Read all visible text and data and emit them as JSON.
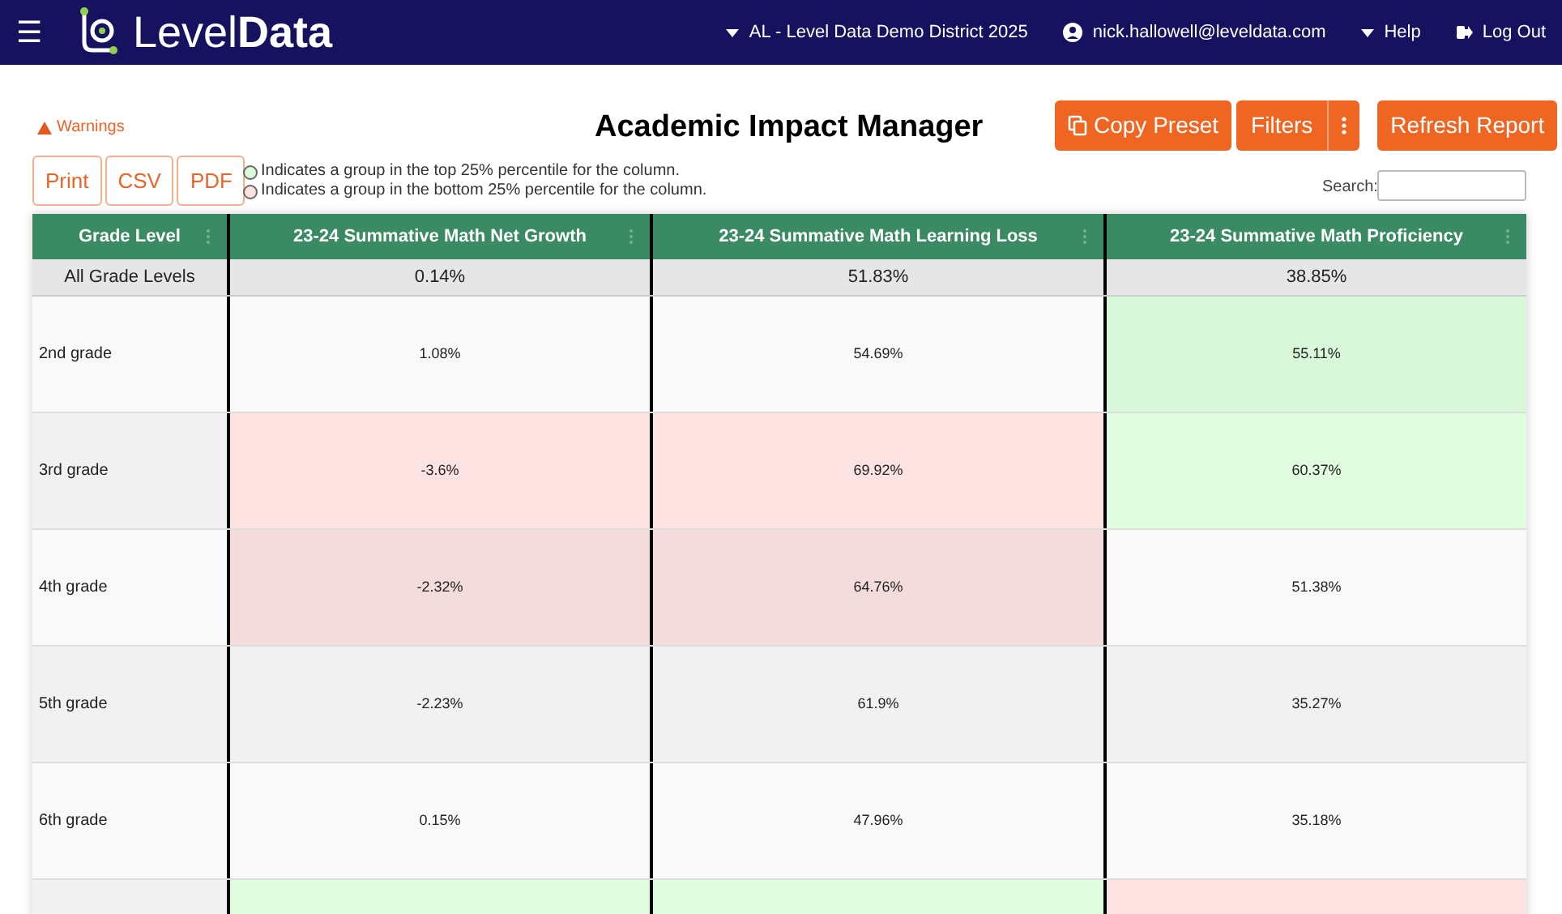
{
  "navbar": {
    "menu_icon": "☰",
    "logo": {
      "light": "Level",
      "bold": "Data"
    },
    "district": "AL - Level Data Demo District 2025",
    "user": "nick.hallowell@leveldata.com",
    "help": "Help",
    "logout": "Log Out"
  },
  "warnings": "Warnings",
  "title": "Academic Impact Manager",
  "actions": [
    {
      "label": "Copy Preset",
      "kind": "copy"
    },
    {
      "label": "Filters",
      "kind": "split"
    },
    {
      "label": "Refresh Report",
      "kind": "plain"
    }
  ],
  "export_buttons": [
    "Print",
    "CSV",
    "PDF"
  ],
  "legend": [
    {
      "text": "Indicates a group in the top 25% percentile for the column.",
      "color": "#d9fbd9"
    },
    {
      "text": "Indicates a group in the bottom 25% percentile for the column.",
      "color": "#fde0e0"
    }
  ],
  "search": {
    "label": "Search:"
  },
  "table": {
    "columns": [
      "Grade Level",
      "23-24 Summative Math Net Growth",
      "23-24 Summative Math Learning Loss",
      "23-24 Summative Math Proficiency"
    ],
    "total": [
      "All Grade Levels",
      "0.14%",
      "51.83%",
      "38.85%"
    ],
    "rows": [
      {
        "cells": [
          {
            "text": "2nd grade",
            "top_25": false,
            "bottom_25": false
          },
          {
            "text": "1.08%",
            "top_25": false,
            "bottom_25": false
          },
          {
            "text": "54.69%",
            "top_25": false,
            "bottom_25": false
          },
          {
            "text": "55.11%",
            "top_25": true,
            "bottom_25": false
          }
        ]
      },
      {
        "cells": [
          {
            "text": "3rd grade",
            "top_25": false,
            "bottom_25": false
          },
          {
            "text": "-3.6%",
            "top_25": false,
            "bottom_25": true
          },
          {
            "text": "69.92%",
            "top_25": false,
            "bottom_25": true
          },
          {
            "text": "60.37%",
            "top_25": true,
            "bottom_25": false
          }
        ]
      },
      {
        "cells": [
          {
            "text": "4th grade",
            "top_25": false,
            "bottom_25": false
          },
          {
            "text": "-2.32%",
            "top_25": false,
            "bottom_25": true
          },
          {
            "text": "64.76%",
            "top_25": false,
            "bottom_25": true
          },
          {
            "text": "51.38%",
            "top_25": false,
            "bottom_25": false
          }
        ]
      },
      {
        "cells": [
          {
            "text": "5th grade",
            "top_25": false,
            "bottom_25": false
          },
          {
            "text": "-2.23%",
            "top_25": false,
            "bottom_25": false
          },
          {
            "text": "61.9%",
            "top_25": false,
            "bottom_25": false
          },
          {
            "text": "35.27%",
            "top_25": false,
            "bottom_25": false
          }
        ]
      },
      {
        "cells": [
          {
            "text": "6th grade",
            "top_25": false,
            "bottom_25": false
          },
          {
            "text": "0.15%",
            "top_25": false,
            "bottom_25": false
          },
          {
            "text": "47.96%",
            "top_25": false,
            "bottom_25": false
          },
          {
            "text": "35.18%",
            "top_25": false,
            "bottom_25": false
          }
        ]
      },
      {
        "cells": [
          {
            "top_25": false,
            "bottom_25": false
          },
          {
            "top_25": true,
            "bottom_25": false
          },
          {
            "top_25": true,
            "bottom_25": false
          },
          {
            "top_25": false,
            "bottom_25": true
          }
        ]
      }
    ]
  }
}
